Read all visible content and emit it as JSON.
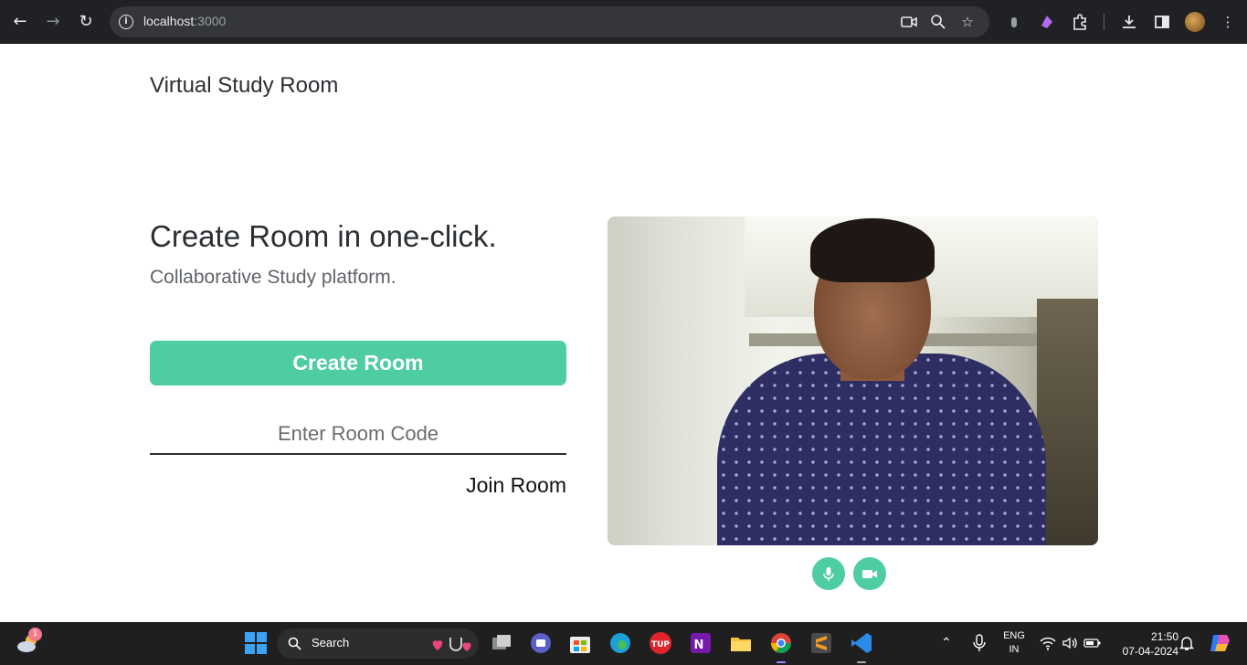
{
  "browser": {
    "url_host": "localhost",
    "url_port": ":3000"
  },
  "header": {
    "brand": "Virtual Study Room"
  },
  "hero": {
    "title": "Create Room in one-click.",
    "subtitle": "Collaborative Study platform.",
    "create_button": "Create Room",
    "room_code_placeholder": "Enter Room Code",
    "join_label": "Join Room"
  },
  "taskbar": {
    "weather_badge": "1",
    "search_label": "Search",
    "language_top": "ENG",
    "language_bottom": "IN",
    "time": "21:50",
    "date": "07-04-2024"
  },
  "colors": {
    "accent": "#4ecca3",
    "chrome_dark": "#202124",
    "taskbar": "#1f1f1f"
  }
}
